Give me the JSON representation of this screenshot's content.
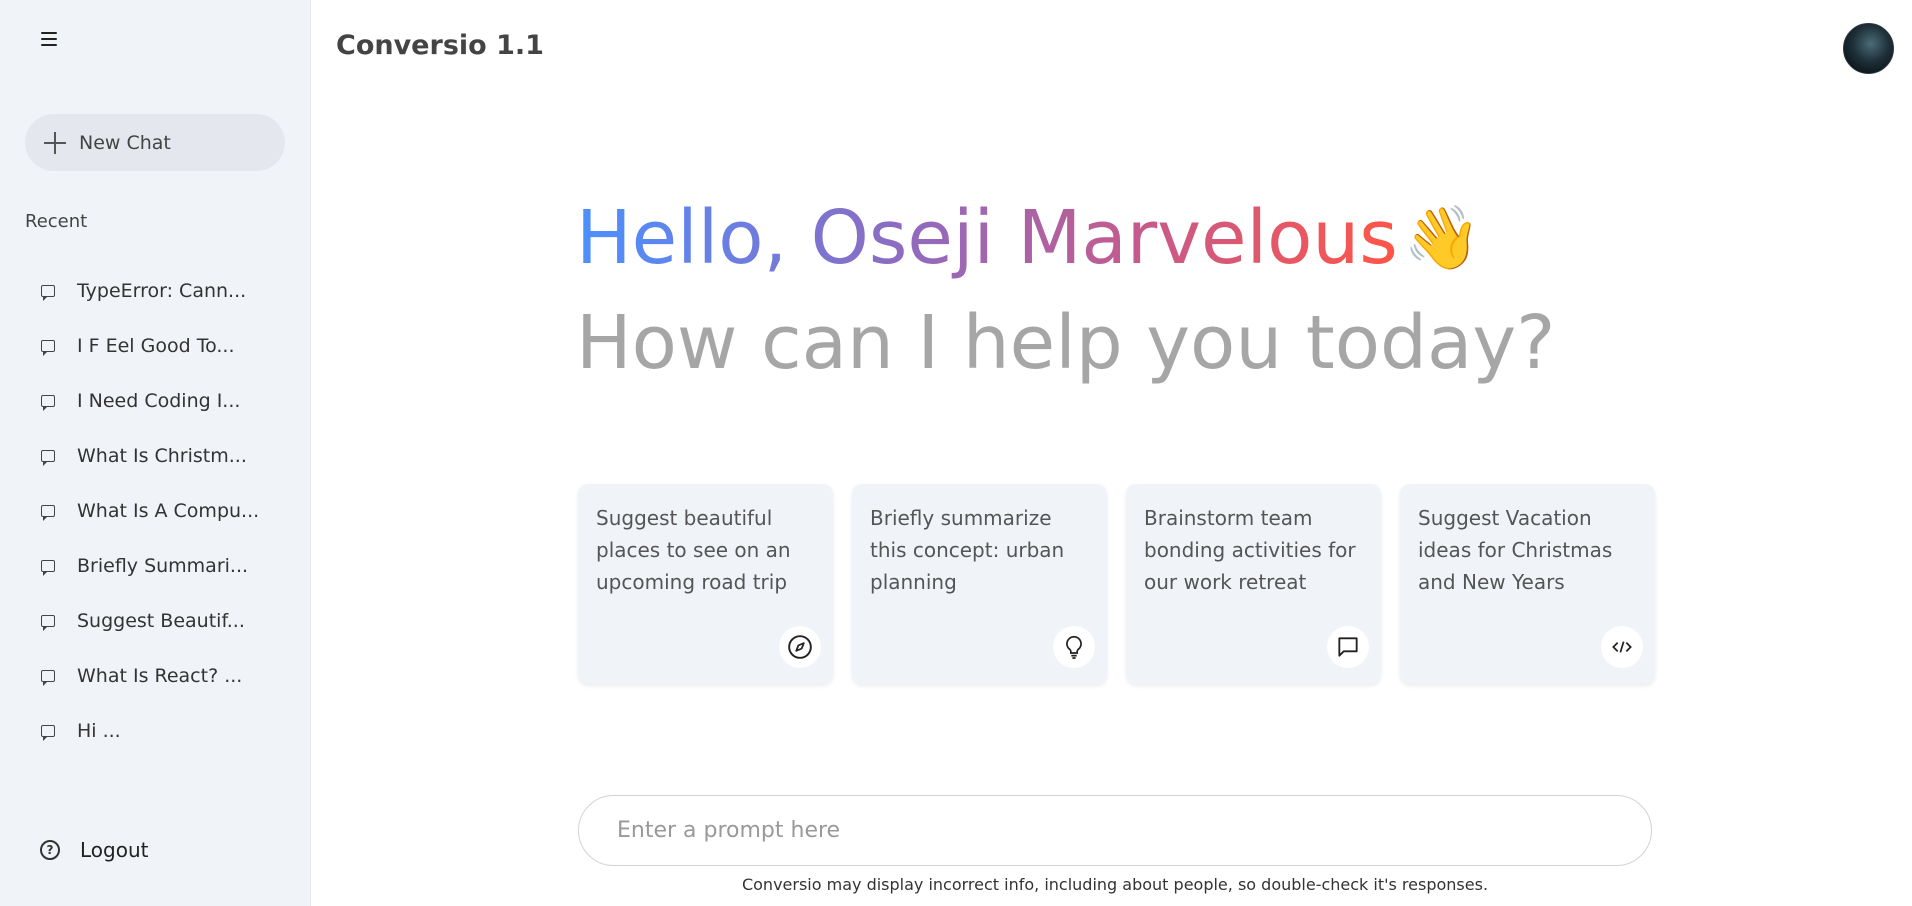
{
  "app": {
    "title": "Conversio 1.1"
  },
  "sidebar": {
    "new_chat_label": "New Chat",
    "recent_title": "Recent",
    "recent_items": [
      {
        "label": "TypeError: Cann..."
      },
      {
        "label": "I F Eel Good To..."
      },
      {
        "label": "I Need Coding I..."
      },
      {
        "label": "What Is Christm..."
      },
      {
        "label": "What Is A Compu..."
      },
      {
        "label": "Briefly Summari..."
      },
      {
        "label": "Suggest Beautif..."
      },
      {
        "label": "What Is React? ..."
      },
      {
        "label": "Hi ..."
      }
    ],
    "logout_label": "Logout"
  },
  "greeting": {
    "name_line": "Hello, Oseji Marvelous",
    "wave_icon": "waving-hand-icon",
    "question": "How can I help you today?"
  },
  "cards": [
    {
      "text": "Suggest beautiful places to see on an upcoming road trip",
      "icon": "compass-icon"
    },
    {
      "text": "Briefly summarize this concept: urban planning",
      "icon": "lightbulb-icon"
    },
    {
      "text": "Brainstorm team bonding activities for our work retreat",
      "icon": "message-icon"
    },
    {
      "text": "Suggest Vacation ideas for Christmas and New Years",
      "icon": "code-icon"
    }
  ],
  "prompt": {
    "placeholder": "Enter a prompt here",
    "value": ""
  },
  "disclaimer": "Conversio may display incorrect info, including about people, so double-check it's responses."
}
